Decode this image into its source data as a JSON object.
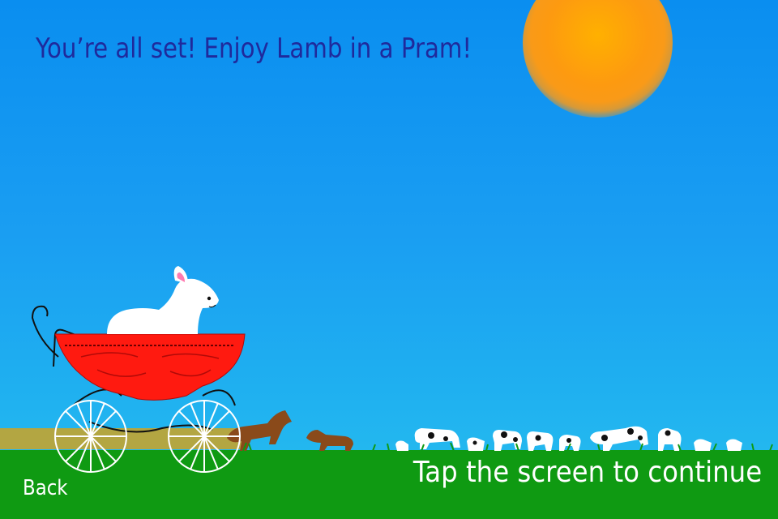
{
  "screen": {
    "headline": "You’re all set! Enjoy Lamb in a Pram!",
    "continue_hint": "Tap the screen to continue",
    "back_label": "Back"
  },
  "colors": {
    "sky": "#1a9ef2",
    "sun": "#fd9a10",
    "headline": "#1f2a9c",
    "grass": "#0f9a12",
    "pram": "#ff1a10",
    "lamb": "#ffffff",
    "horse": "#8a4a1a",
    "cow": "#ffffff"
  },
  "icons": {
    "sun": "sun-icon",
    "lamb": "lamb-icon",
    "pram": "pram-icon",
    "horse": "horse-icon",
    "cow": "cow-icon"
  }
}
